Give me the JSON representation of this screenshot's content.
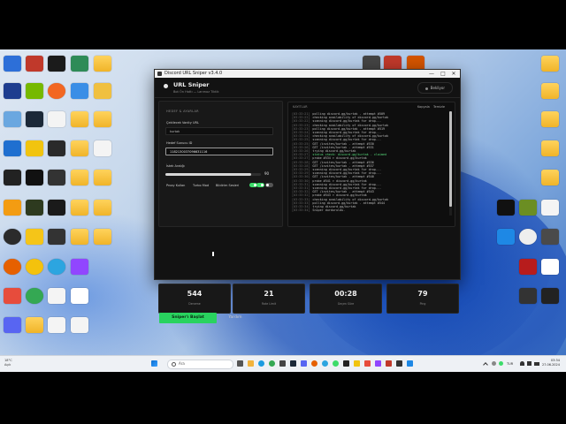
{
  "window": {
    "title": "Discord URL Sniper v3.4.0",
    "minimize": "—",
    "maximize": "□",
    "close": "✕"
  },
  "header": {
    "title": "URL Sniper",
    "subtitle": "Bot Ön Hattı — Lanmoz Tiktik",
    "status": "Bekliyor"
  },
  "settings": {
    "section": "HEDEF & AYARLAR",
    "vanity_label": "Çekilecek Vanity URL",
    "vanity_value": "kurtak",
    "server_label": "Hedef Sunucu ID",
    "server_value": "1182130037096631116",
    "interval_label": "İstek Aralığı",
    "interval_value": "90",
    "interval_fraction": 0.9,
    "proxy_label": "Proxy Kullan",
    "turbo_label": "Turbo Mod",
    "notify_label": "Bildirim Sesleri",
    "toggles": [
      true,
      true,
      false
    ]
  },
  "log": {
    "title": "KAYITLAR",
    "copy": "Kopyala",
    "clear": "Temizle",
    "lines": [
      {
        "t": "[03:33:21]",
        "m": "polling discord.gg/kurtak - attempt #509",
        "ok": false
      },
      {
        "t": "[03:33:22]",
        "m": "checking availability of discord.gg/kurtak",
        "ok": false
      },
      {
        "t": "[03:33:22]",
        "m": "scanning discord.gg/kurtak for drop...",
        "ok": false
      },
      {
        "t": "[03:33:23]",
        "m": "checking availability of discord.gg/kurtak",
        "ok": false
      },
      {
        "t": "[03:33:23]",
        "m": "polling discord.gg/kurtak - attempt #519",
        "ok": false
      },
      {
        "t": "[03:33:24]",
        "m": "scanning discord.gg/kurtak for drop...",
        "ok": false
      },
      {
        "t": "[03:33:24]",
        "m": "checking availability of discord.gg/kurtak",
        "ok": false
      },
      {
        "t": "[03:33:25]",
        "m": "scanning discord.gg/kurtak for drop...",
        "ok": false
      },
      {
        "t": "[03:33:25]",
        "m": "GET /invites/kurtak - attempt #530",
        "ok": false
      },
      {
        "t": "[03:33:26]",
        "m": "GET /invites/kurtak - attempt #531",
        "ok": false
      },
      {
        "t": "[03:33:26]",
        "m": "trying discord.gg/kurtak",
        "ok": false
      },
      {
        "t": "[03:33:27]",
        "m": "status check: discord.gg/kurtak - claimed",
        "ok": true
      },
      {
        "t": "[03:33:27]",
        "m": "probe #534 > discord.gg/kurtak",
        "ok": false
      },
      {
        "t": "[03:33:28]",
        "m": "GET /invites/kurtak - attempt #536",
        "ok": false
      },
      {
        "t": "[03:33:28]",
        "m": "GET /invites/kurtak - attempt #537",
        "ok": false
      },
      {
        "t": "[03:33:29]",
        "m": "scanning discord.gg/kurtak for drop...",
        "ok": false
      },
      {
        "t": "[03:33:29]",
        "m": "scanning discord.gg/kurtak for drop...",
        "ok": false
      },
      {
        "t": "[03:33:30]",
        "m": "GET /invites/kurtak - attempt #540",
        "ok": false
      },
      {
        "t": "[03:33:30]",
        "m": "probe #541 > discord.gg/kurtak",
        "ok": false
      },
      {
        "t": "[03:33:31]",
        "m": "scanning discord.gg/kurtak for drop...",
        "ok": false
      },
      {
        "t": "[03:33:31]",
        "m": "scanning discord.gg/kurtak for drop...",
        "ok": false
      },
      {
        "t": "[03:33:32]",
        "m": "GET /invites/kurtak - attempt #543",
        "ok": false
      },
      {
        "t": "[03:33:32]",
        "m": "probe #543 > discord.gg/kurtak",
        "ok": false
      },
      {
        "t": "[03:33:33]",
        "m": "checking availability of discord.gg/kurtak",
        "ok": false
      },
      {
        "t": "[03:33:33]",
        "m": "polling discord.gg/kurtak - attempt #544",
        "ok": false
      },
      {
        "t": "[03:33:34]",
        "m": "trying discord.gg/kurtak",
        "ok": false
      },
      {
        "t": "[03:33:34]",
        "m": "Sniper durduruldu.",
        "ok": false
      }
    ]
  },
  "stats": [
    {
      "value": "544",
      "label": "Deneme"
    },
    {
      "value": "21",
      "label": "Rate Limit"
    },
    {
      "value": "00:28",
      "label": "Geçen Süre"
    },
    {
      "value": "79",
      "label": "Ping"
    }
  ],
  "buttons": {
    "start": "Sniper'ı Başlat",
    "help": "Yardım"
  },
  "taskbar": {
    "weather_temp": "18°C",
    "weather_desc": "Açık",
    "search_placeholder": "Ara",
    "lang": "TUR",
    "time": "03:34",
    "date": "27.06.2024"
  },
  "colors": {
    "accent_green": "#29d35f",
    "window_bg": "#121212",
    "panel_bg": "#181818"
  }
}
